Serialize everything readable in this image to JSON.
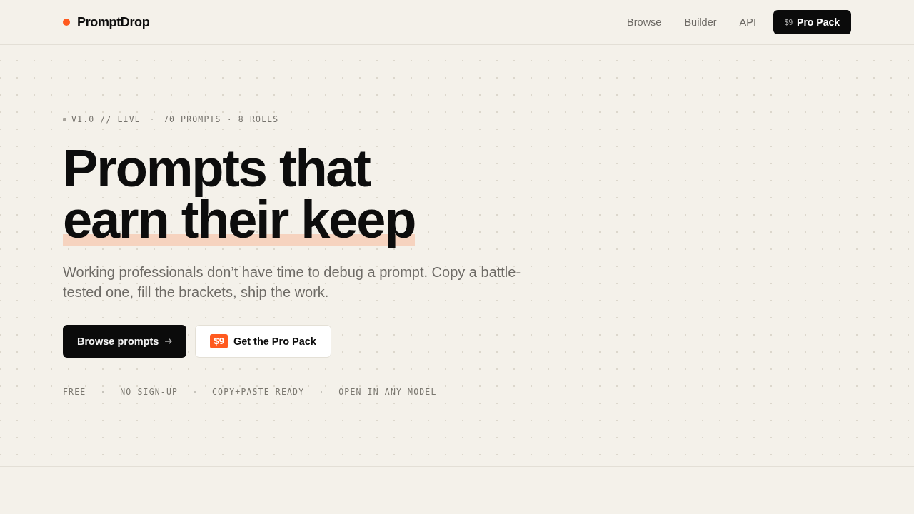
{
  "header": {
    "brand": "PromptDrop",
    "nav": [
      "Browse",
      "Builder",
      "API"
    ],
    "cta": {
      "price": "$9",
      "label": "Pro Pack"
    }
  },
  "hero": {
    "eyebrow": {
      "status": "V1.0 // LIVE",
      "stats": "70 PROMPTS · 8 ROLES"
    },
    "headline": [
      {
        "text": "Prompts that",
        "highlighted": false
      },
      {
        "text": "earn their keep",
        "highlighted": true
      }
    ],
    "description": "Working professionals don’t have time to debug a prompt. Copy a battle-tested one, fill the brackets, ship the work.",
    "actions": [
      {
        "kind": "primary",
        "label": "Browse prompts"
      },
      {
        "kind": "secondary",
        "price": "$9",
        "label": "Get the Pro Pack"
      }
    ],
    "features": [
      "FREE",
      "NO SIGN-UP",
      "COPY+PASTE READY",
      "OPEN IN ANY MODEL"
    ]
  }
}
